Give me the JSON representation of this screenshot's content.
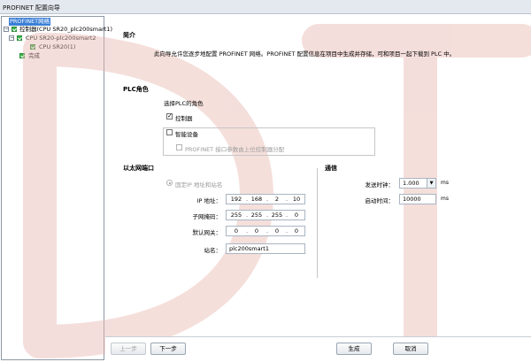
{
  "window": {
    "title": "PROFINET 配置向导"
  },
  "tree": {
    "items": [
      {
        "label": "PROFINET网络",
        "selected": true
      },
      {
        "label": "控制器(CPU SR20_plc200smart1)"
      },
      {
        "label": "CPU SR20-plc200smart2"
      },
      {
        "label": "CPU SR20(1)"
      },
      {
        "label": "完成"
      }
    ]
  },
  "intro": {
    "heading": "简介",
    "text": "此向导允许您逐步地配置 PROFINET 网络。PROFINET 配置信息在项目中生成并存储，可和项目一起下载到 PLC 中。"
  },
  "plc_role": {
    "heading": "PLC角色",
    "prompt": "选择PLC的角色",
    "controller_label": "控制器",
    "controller_checked": true,
    "smart_device_label": "智能设备",
    "smart_device_checked": false,
    "profinet_assign_label": "PROFINET 接口参数由上位控制器分配",
    "profinet_assign_checked": false
  },
  "ethernet": {
    "heading": "以太网端口",
    "fixed_ip_label": "固定IP 地址和站名",
    "ip_label": "IP 地址：",
    "ip": [
      "192",
      "168",
      "2",
      "10"
    ],
    "subnet_label": "子网掩码：",
    "subnet": [
      "255",
      "255",
      "255",
      "0"
    ],
    "gateway_label": "默认网关：",
    "gateway": [
      "0",
      "0",
      "0",
      "0"
    ],
    "station_label": "站名：",
    "station_name": "plc200smart1"
  },
  "comm": {
    "heading": "通信",
    "send_clock_label": "发送时钟：",
    "send_clock_value": "1.000",
    "send_clock_unit": "ms",
    "startup_label": "启动时间：",
    "startup_value": "10000",
    "startup_unit": "ms"
  },
  "footer": {
    "prev": "上一步",
    "next": "下一步",
    "generate": "生成",
    "cancel": "取消"
  },
  "colors": {
    "selection": "#3b7fd6",
    "watermark": "#e8b7b0",
    "tree_check": "#3bb34a"
  }
}
